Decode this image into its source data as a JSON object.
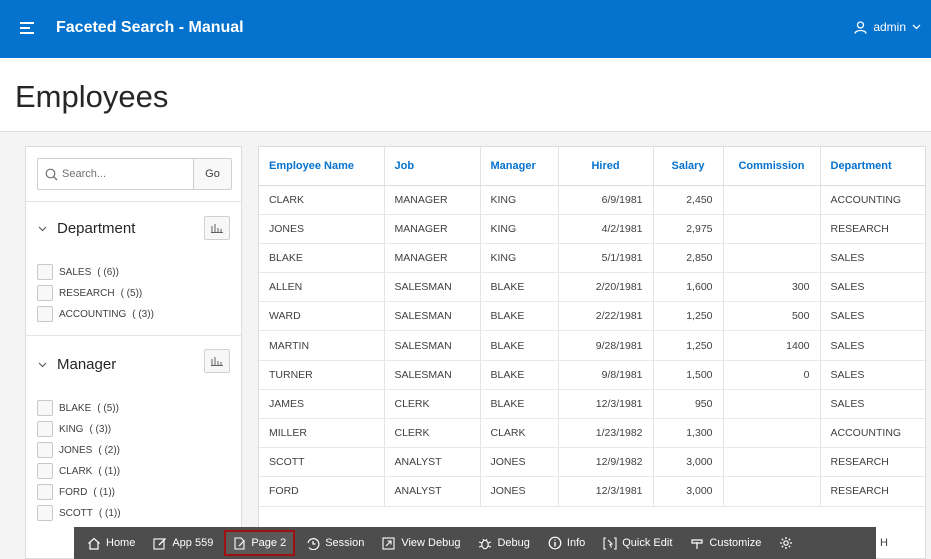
{
  "header": {
    "title": "Faceted Search - Manual",
    "user": "admin"
  },
  "page": {
    "title": "Employees"
  },
  "search": {
    "placeholder": "Search...",
    "go_label": "Go"
  },
  "facets": {
    "department": {
      "label": "Department",
      "items": [
        {
          "label": "SALES",
          "count": "( (6))"
        },
        {
          "label": "RESEARCH",
          "count": "( (5))"
        },
        {
          "label": "ACCOUNTING",
          "count": "( (3))"
        }
      ]
    },
    "manager": {
      "label": "Manager",
      "items": [
        {
          "label": "BLAKE",
          "count": "( (5))"
        },
        {
          "label": "KING",
          "count": "( (3))"
        },
        {
          "label": "JONES",
          "count": "( (2))"
        },
        {
          "label": "CLARK",
          "count": "( (1))"
        },
        {
          "label": "FORD",
          "count": "( (1))"
        },
        {
          "label": "SCOTT",
          "count": "( (1))"
        }
      ]
    }
  },
  "table": {
    "columns": [
      "Employee Name",
      "Job",
      "Manager",
      "Hired",
      "Salary",
      "Commission",
      "Department"
    ],
    "rows": [
      [
        "CLARK",
        "MANAGER",
        "KING",
        "6/9/1981",
        "2,450",
        "",
        "ACCOUNTING"
      ],
      [
        "JONES",
        "MANAGER",
        "KING",
        "4/2/1981",
        "2,975",
        "",
        "RESEARCH"
      ],
      [
        "BLAKE",
        "MANAGER",
        "KING",
        "5/1/1981",
        "2,850",
        "",
        "SALES"
      ],
      [
        "ALLEN",
        "SALESMAN",
        "BLAKE",
        "2/20/1981",
        "1,600",
        "300",
        "SALES"
      ],
      [
        "WARD",
        "SALESMAN",
        "BLAKE",
        "2/22/1981",
        "1,250",
        "500",
        "SALES"
      ],
      [
        "MARTIN",
        "SALESMAN",
        "BLAKE",
        "9/28/1981",
        "1,250",
        "1400",
        "SALES"
      ],
      [
        "TURNER",
        "SALESMAN",
        "BLAKE",
        "9/8/1981",
        "1,500",
        "0",
        "SALES"
      ],
      [
        "JAMES",
        "CLERK",
        "BLAKE",
        "12/3/1981",
        "950",
        "",
        "SALES"
      ],
      [
        "MILLER",
        "CLERK",
        "CLARK",
        "1/23/1982",
        "1,300",
        "",
        "ACCOUNTING"
      ],
      [
        "SCOTT",
        "ANALYST",
        "JONES",
        "12/9/1982",
        "3,000",
        "",
        "RESEARCH"
      ],
      [
        "FORD",
        "ANALYST",
        "JONES",
        "12/3/1981",
        "3,000",
        "",
        "RESEARCH"
      ]
    ]
  },
  "devbar": {
    "home": "Home",
    "app": "App 559",
    "page": "Page 2",
    "session": "Session",
    "view_debug": "View Debug",
    "debug": "Debug",
    "info": "Info",
    "quick_edit": "Quick Edit",
    "customize": "Customize",
    "trail": "H"
  },
  "colors": {
    "brand": "#0572ce",
    "devbar": "#4d4d4d",
    "active_outline": "#a01010"
  }
}
